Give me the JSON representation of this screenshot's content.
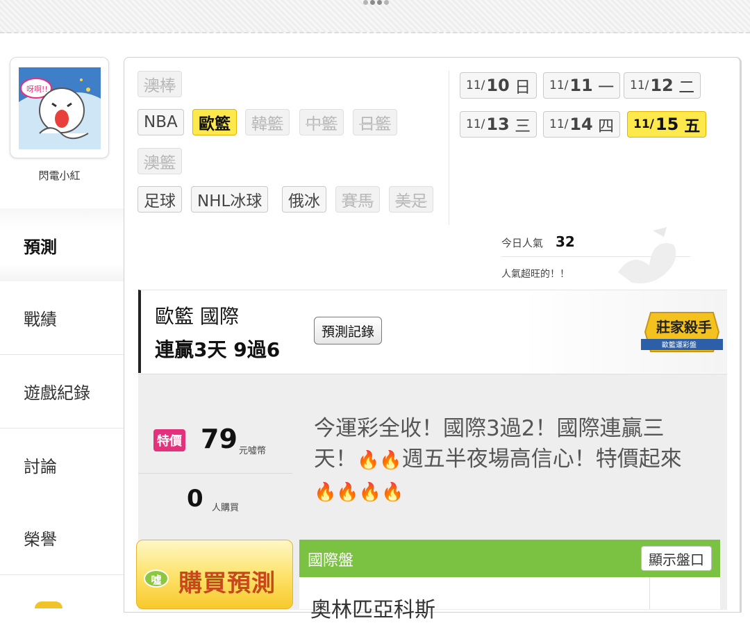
{
  "user": {
    "name": "閃電小紅",
    "avatar_text": "呀啊!!"
  },
  "sidebar": {
    "items": [
      {
        "label": "預測",
        "active": true
      },
      {
        "label": "戰績"
      },
      {
        "label": "遊戲紀錄"
      },
      {
        "label": "討論"
      },
      {
        "label": "榮譽"
      }
    ]
  },
  "sports": [
    {
      "label": "澳棒",
      "state": "disabled"
    },
    {
      "label": "NBA",
      "state": "normal"
    },
    {
      "label": "歐籃",
      "state": "selected"
    },
    {
      "label": "韓籃",
      "state": "disabled"
    },
    {
      "label": "中籃",
      "state": "disabled"
    },
    {
      "label": "日籃",
      "state": "disabled"
    },
    {
      "label": "澳籃",
      "state": "disabled"
    },
    {
      "label": "足球",
      "state": "normal"
    },
    {
      "label": "NHL冰球",
      "state": "normal"
    },
    {
      "label": "俄冰",
      "state": "normal"
    },
    {
      "label": "賽馬",
      "state": "disabled"
    },
    {
      "label": "美足",
      "state": "disabled"
    }
  ],
  "dates": [
    {
      "md": "11/",
      "d": "10",
      "wd": "日"
    },
    {
      "md": "11/",
      "d": "11",
      "wd": "一"
    },
    {
      "md": "11/",
      "d": "12",
      "wd": "二"
    },
    {
      "md": "11/",
      "d": "13",
      "wd": "三"
    },
    {
      "md": "11/",
      "d": "14",
      "wd": "四"
    },
    {
      "md": "11/",
      "d": "15",
      "wd": "五",
      "selected": true
    }
  ],
  "popularity": {
    "label": "今日人氣",
    "value": "32",
    "note": "人氣超旺的！！"
  },
  "league": {
    "line1": "歐籃 國際",
    "line2": "連贏3天 9過6",
    "record_button": "預測記錄",
    "badge_title": "莊家殺手",
    "badge_sub": "歐籃運彩盤"
  },
  "offer": {
    "badge": "特價",
    "price": "79",
    "price_unit": "元噓幣",
    "buyers": "0",
    "buyers_unit": "人購買"
  },
  "promo": {
    "text1": "今運彩全收！國際3過2！國際連贏三天！",
    "text2": "週五半夜場高信心！特價起來"
  },
  "buy": {
    "coin": "噓",
    "label": "購買預測"
  },
  "market": {
    "title": "國際盤",
    "show_button": "顯示盤口",
    "team": "奧林匹亞科斯"
  },
  "colors": {
    "selected": "#fde94b",
    "green": "#7cc242",
    "badge": "#e4317c",
    "buy_text": "#c8471d"
  }
}
